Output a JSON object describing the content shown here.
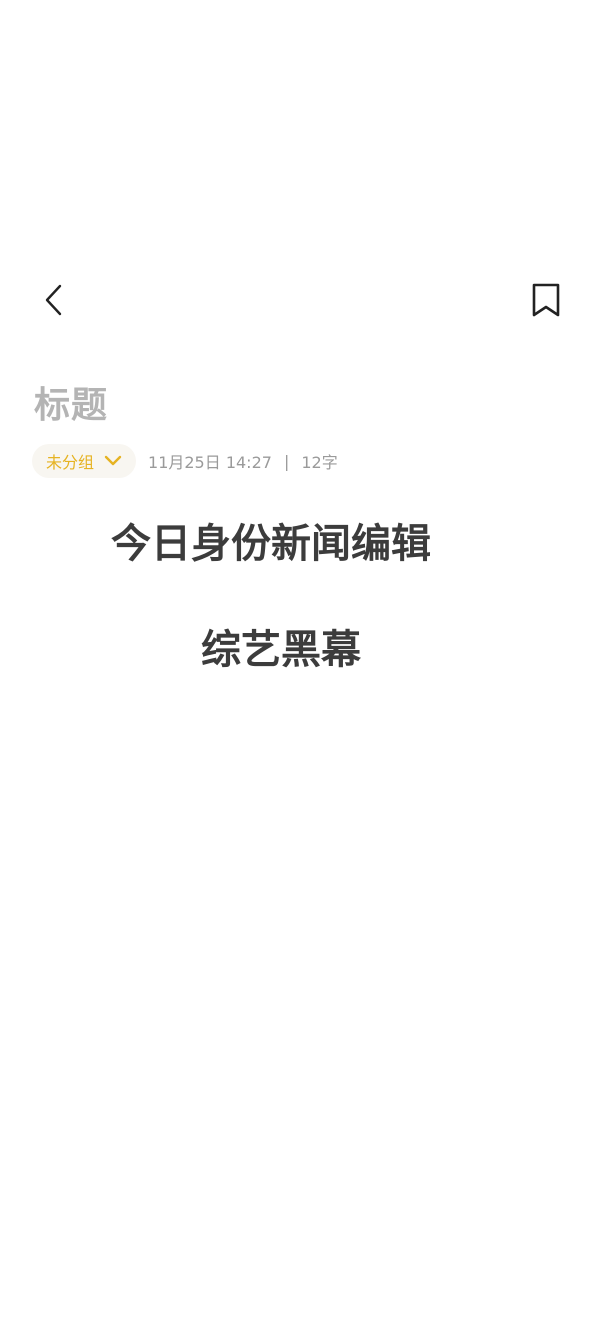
{
  "header": {
    "back_icon": "chevron-left-icon",
    "bookmark_icon": "bookmark-icon"
  },
  "note": {
    "title_placeholder": "标题",
    "group_label": "未分组",
    "group_chevron_icon": "chevron-down-icon",
    "datetime": "11月25日 14:27",
    "separator": "|",
    "word_count": "12字",
    "body_lines": [
      "今日身份新闻编辑",
      "综艺黑幕"
    ]
  },
  "colors": {
    "accent": "#e6b322",
    "title_placeholder": "#b4b4b4",
    "meta_text": "#9a9a9a",
    "body_text": "#3c3c3c",
    "chip_background": "#f8f6f1"
  }
}
